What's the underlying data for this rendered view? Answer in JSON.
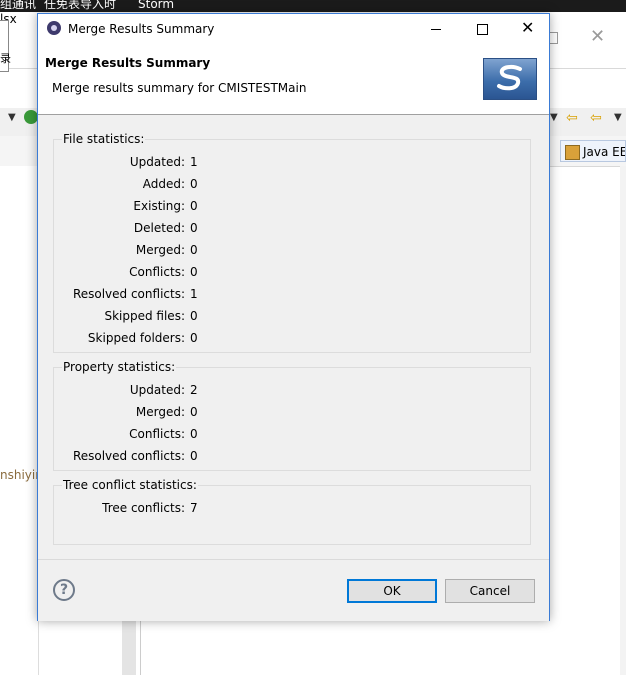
{
  "background": {
    "taskbar_items": [
      "组通讯",
      "任免表导入时",
      "Storm"
    ],
    "file_label": "lsx",
    "side_char": "录",
    "perspective_label": "Java EE",
    "left_pane_text": "nshiying"
  },
  "dialog": {
    "window_title": "Merge Results Summary",
    "header_title": "Merge Results Summary",
    "header_subtitle": "Merge results summary for CMISTESTMain",
    "close_glyph": "✕",
    "groups": {
      "file": {
        "title": "File statistics:",
        "rows": [
          {
            "label": "Updated:",
            "value": "1"
          },
          {
            "label": "Added:",
            "value": "0"
          },
          {
            "label": "Existing:",
            "value": "0"
          },
          {
            "label": "Deleted:",
            "value": "0"
          },
          {
            "label": "Merged:",
            "value": "0"
          },
          {
            "label": "Conflicts:",
            "value": "0"
          },
          {
            "label": "Resolved conflicts:",
            "value": "1"
          },
          {
            "label": "Skipped files:",
            "value": "0"
          },
          {
            "label": "Skipped folders:",
            "value": "0"
          }
        ]
      },
      "property": {
        "title": "Property statistics:",
        "rows": [
          {
            "label": "Updated:",
            "value": "2"
          },
          {
            "label": "Merged:",
            "value": "0"
          },
          {
            "label": "Conflicts:",
            "value": "0"
          },
          {
            "label": "Resolved conflicts:",
            "value": "0"
          }
        ]
      },
      "tree": {
        "title": "Tree conflict statistics:",
        "rows": [
          {
            "label": "Tree conflicts:",
            "value": "7"
          }
        ]
      }
    },
    "buttons": {
      "help_glyph": "?",
      "ok": "OK",
      "cancel": "Cancel"
    }
  }
}
